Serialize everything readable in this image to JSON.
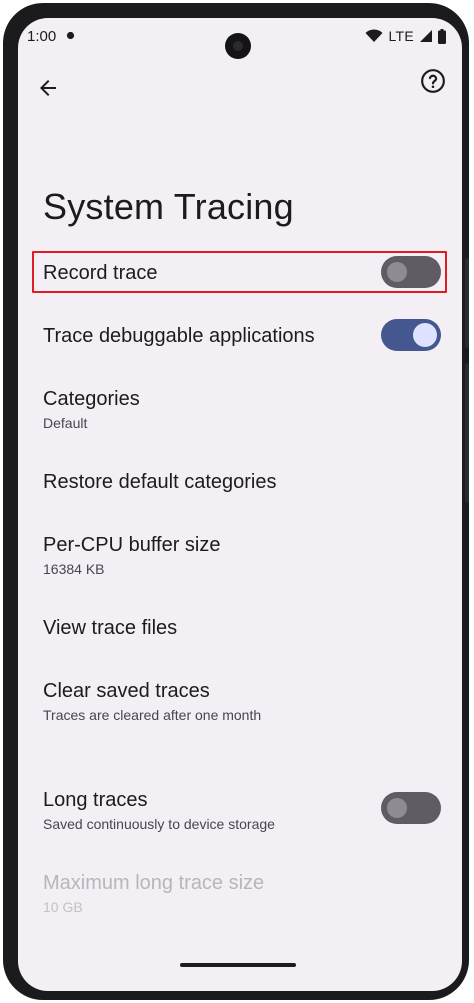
{
  "status_bar": {
    "time": "1:00",
    "network": "LTE",
    "icons": [
      "notification-dot-icon",
      "wifi-icon",
      "signal-icon",
      "battery-icon"
    ]
  },
  "app_bar": {
    "back_icon": "arrow-back-icon",
    "help_icon": "help-circle-icon"
  },
  "page": {
    "title": "System Tracing"
  },
  "preferences": {
    "record_trace": {
      "title": "Record trace",
      "enabled": false
    },
    "trace_debuggable": {
      "title": "Trace debuggable applications",
      "enabled": true
    },
    "categories": {
      "title": "Categories",
      "summary": "Default"
    },
    "restore_defaults": {
      "title": "Restore default categories"
    },
    "buffer_size": {
      "title": "Per-CPU buffer size",
      "summary": "16384 KB"
    },
    "view_files": {
      "title": "View trace files"
    },
    "clear_saved": {
      "title": "Clear saved traces",
      "summary": "Traces are cleared after one month"
    },
    "long_traces": {
      "title": "Long traces",
      "summary": "Saved continuously to device storage",
      "enabled": false
    },
    "max_long_trace": {
      "title": "Maximum long trace size",
      "summary": "10 GB",
      "disabled": true
    }
  },
  "colors": {
    "background": "#f3eff4",
    "toggle_on": "#44578f",
    "toggle_off": "#5f5d63",
    "highlight": "#e01b24"
  }
}
